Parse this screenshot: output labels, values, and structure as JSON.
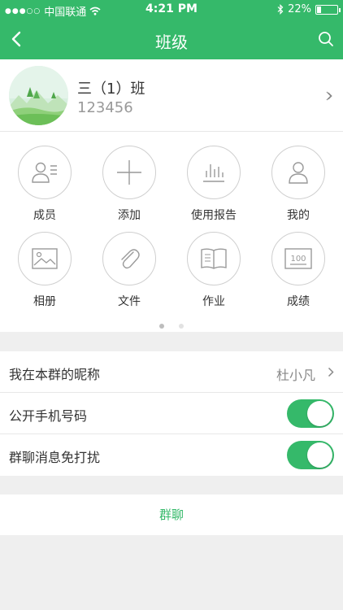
{
  "status_bar": {
    "carrier": "中国联通",
    "time": "4:21 PM",
    "battery": "22%",
    "battery_level": 0.22
  },
  "nav": {
    "title": "班级",
    "back_icon": "chevron-left-icon",
    "search_icon": "search-icon"
  },
  "profile": {
    "name": "三（1）班",
    "id": "123456"
  },
  "grid": [
    {
      "label": "成员",
      "icon": "member-icon"
    },
    {
      "label": "添加",
      "icon": "plus-icon"
    },
    {
      "label": "使用报告",
      "icon": "report-chart-icon"
    },
    {
      "label": "我的",
      "icon": "user-icon"
    },
    {
      "label": "相册",
      "icon": "photo-album-icon"
    },
    {
      "label": "文件",
      "icon": "paperclip-icon"
    },
    {
      "label": "作业",
      "icon": "book-icon"
    },
    {
      "label": "成绩",
      "icon": "score-icon"
    }
  ],
  "settings": [
    {
      "label": "我在本群的昵称",
      "value": "杜小凡"
    },
    {
      "label": "公开手机号码",
      "toggle": true
    },
    {
      "label": "群聊消息免打扰",
      "toggle": true
    }
  ],
  "chat_button": "群聊",
  "colors": {
    "accent": "#35b96a",
    "background": "#efefef"
  }
}
